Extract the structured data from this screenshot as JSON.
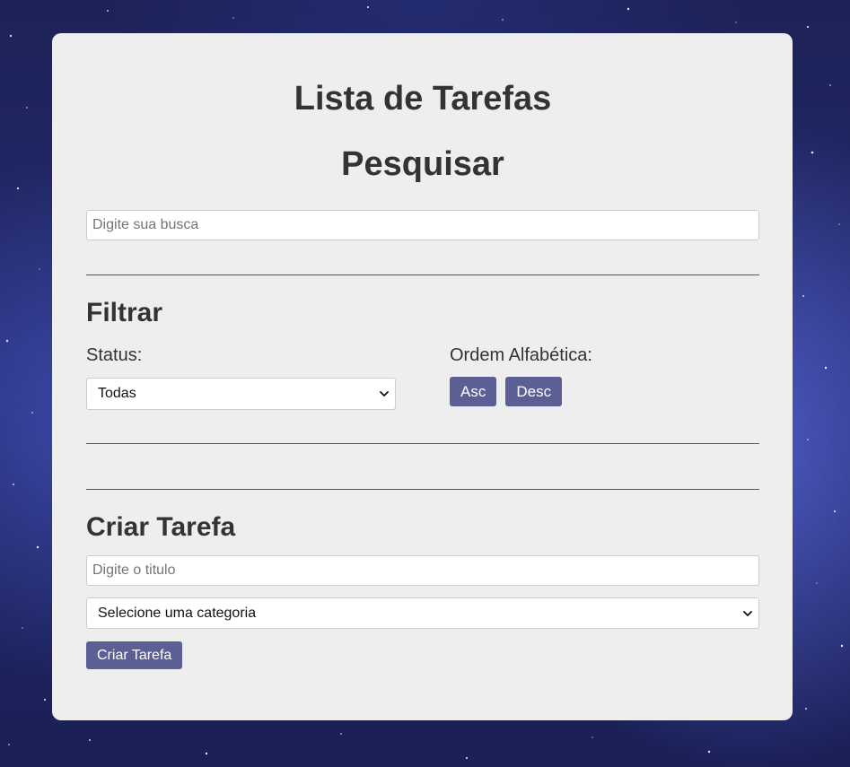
{
  "page": {
    "title": "Lista de Tarefas"
  },
  "search": {
    "heading": "Pesquisar",
    "placeholder": "Digite sua busca",
    "value": ""
  },
  "filter": {
    "heading": "Filtrar",
    "status_label": "Status:",
    "status_selected": "Todas",
    "order_label": "Ordem Alfabética:",
    "asc_label": "Asc",
    "desc_label": "Desc"
  },
  "tasks": {
    "items": []
  },
  "create": {
    "heading": "Criar Tarefa",
    "title_placeholder": "Digite o titulo",
    "title_value": "",
    "category_selected": "Selecione uma categoria",
    "submit_label": "Criar Tarefa"
  },
  "colors": {
    "card_background": "#eeeeee",
    "button_background": "#5c5f93",
    "text": "#333333",
    "page_background": "#232a6e"
  },
  "icons": {
    "select_arrow": "chevron-down-icon"
  }
}
